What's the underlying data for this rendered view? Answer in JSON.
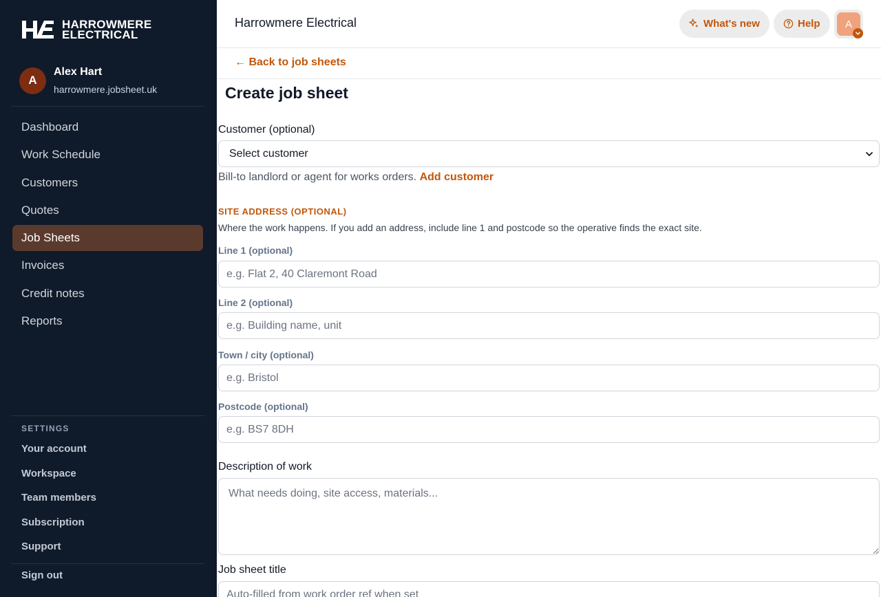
{
  "sidebar": {
    "brand_line1": "HARROWMERE",
    "brand_line2": "ELECTRICAL",
    "user": {
      "initial": "A",
      "name": "Alex Hart",
      "domain": "harrowmere.jobsheet.uk"
    },
    "nav": [
      {
        "label": "Dashboard",
        "active": false
      },
      {
        "label": "Work Schedule",
        "active": false
      },
      {
        "label": "Customers",
        "active": false
      },
      {
        "label": "Quotes",
        "active": false
      },
      {
        "label": "Job Sheets",
        "active": true
      },
      {
        "label": "Invoices",
        "active": false
      },
      {
        "label": "Credit notes",
        "active": false
      },
      {
        "label": "Reports",
        "active": false
      }
    ],
    "settings_heading": "SETTINGS",
    "settings": [
      {
        "label": "Your account"
      },
      {
        "label": "Workspace"
      },
      {
        "label": "Team members"
      },
      {
        "label": "Subscription"
      },
      {
        "label": "Support"
      }
    ],
    "sign_out": "Sign out"
  },
  "header": {
    "title": "Harrowmere Electrical",
    "whats_new": "What's new",
    "help": "Help",
    "avatar_initial": "A"
  },
  "back_link": "← Back to job sheets",
  "form": {
    "title": "Create job sheet",
    "customer_label": "Customer (optional)",
    "customer_selected": "Select customer",
    "customer_hint": "Bill-to landlord or agent for works orders.",
    "add_customer": "Add customer",
    "site_heading": "SITE ADDRESS (OPTIONAL)",
    "site_desc": "Where the work happens. If you add an address, include line 1 and postcode so the operative finds the exact site.",
    "line1_label": "Line 1 (optional)",
    "line1_placeholder": "e.g. Flat 2, 40 Claremont Road",
    "line2_label": "Line 2 (optional)",
    "line2_placeholder": "e.g. Building name, unit",
    "town_label": "Town / city (optional)",
    "town_placeholder": "e.g. Bristol",
    "postcode_label": "Postcode (optional)",
    "postcode_placeholder": "e.g. BS7 8DH",
    "description_label": "Description of work",
    "description_placeholder": "What needs doing, site access, materials...",
    "jobtitle_label": "Job sheet title",
    "jobtitle_placeholder": "Auto-filled from work order ref when set"
  },
  "colors": {
    "sidebar_bg": "#0f1a2a",
    "accent": "#c2570c",
    "active_nav": "#5b3a2e"
  }
}
